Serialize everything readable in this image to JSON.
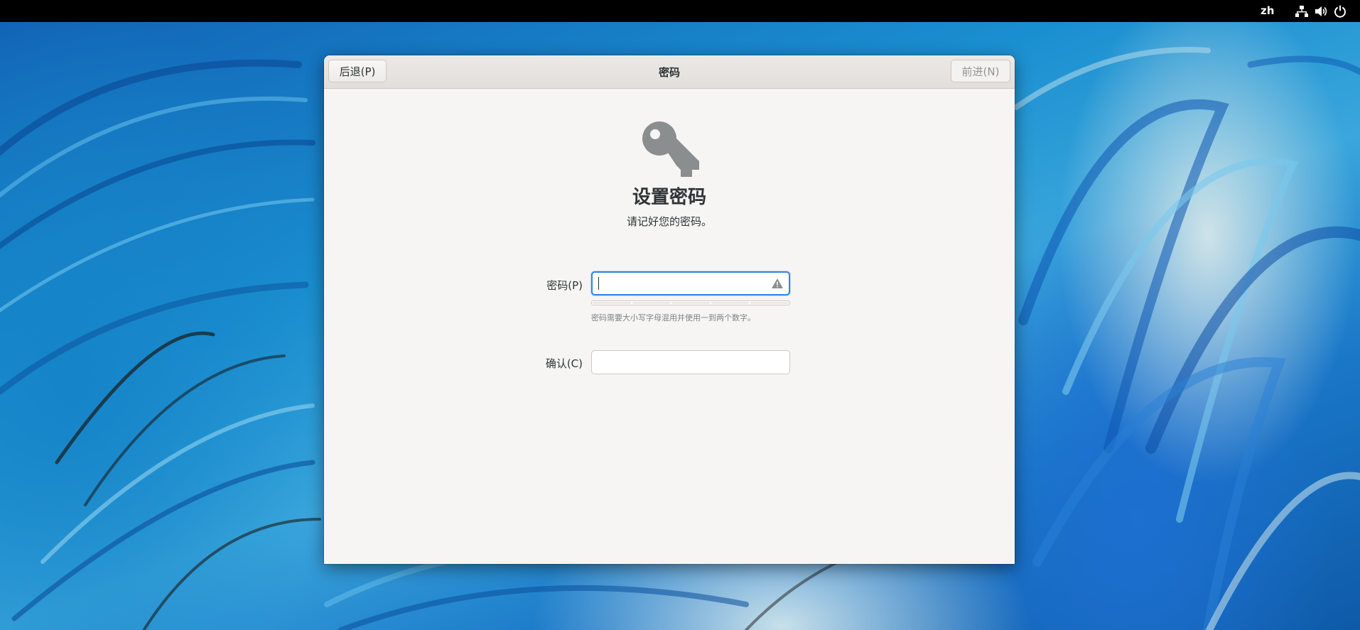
{
  "topbar": {
    "language": "zh",
    "icons": [
      "network-icon",
      "volume-icon",
      "power-icon"
    ]
  },
  "window": {
    "title": "密码",
    "back_label": "后退(P)",
    "forward_label": "前进(N)",
    "forward_enabled": false
  },
  "page": {
    "icon": "key-icon",
    "heading": "设置密码",
    "subtitle": "请记好您的密码。"
  },
  "form": {
    "password_label": "密码(P)",
    "password_value": "",
    "password_warning_icon": "warning-icon",
    "strength_level": 0,
    "strength_segments": 5,
    "hint": "密码需要大小写字母混用并使用一到两个数字。",
    "confirm_label": "确认(C)",
    "confirm_value": ""
  },
  "colors": {
    "topbar": "#000000",
    "focus_accent": "#3584e4",
    "window_bg": "#f6f5f4",
    "icon_gray": "#8b8e8f"
  }
}
